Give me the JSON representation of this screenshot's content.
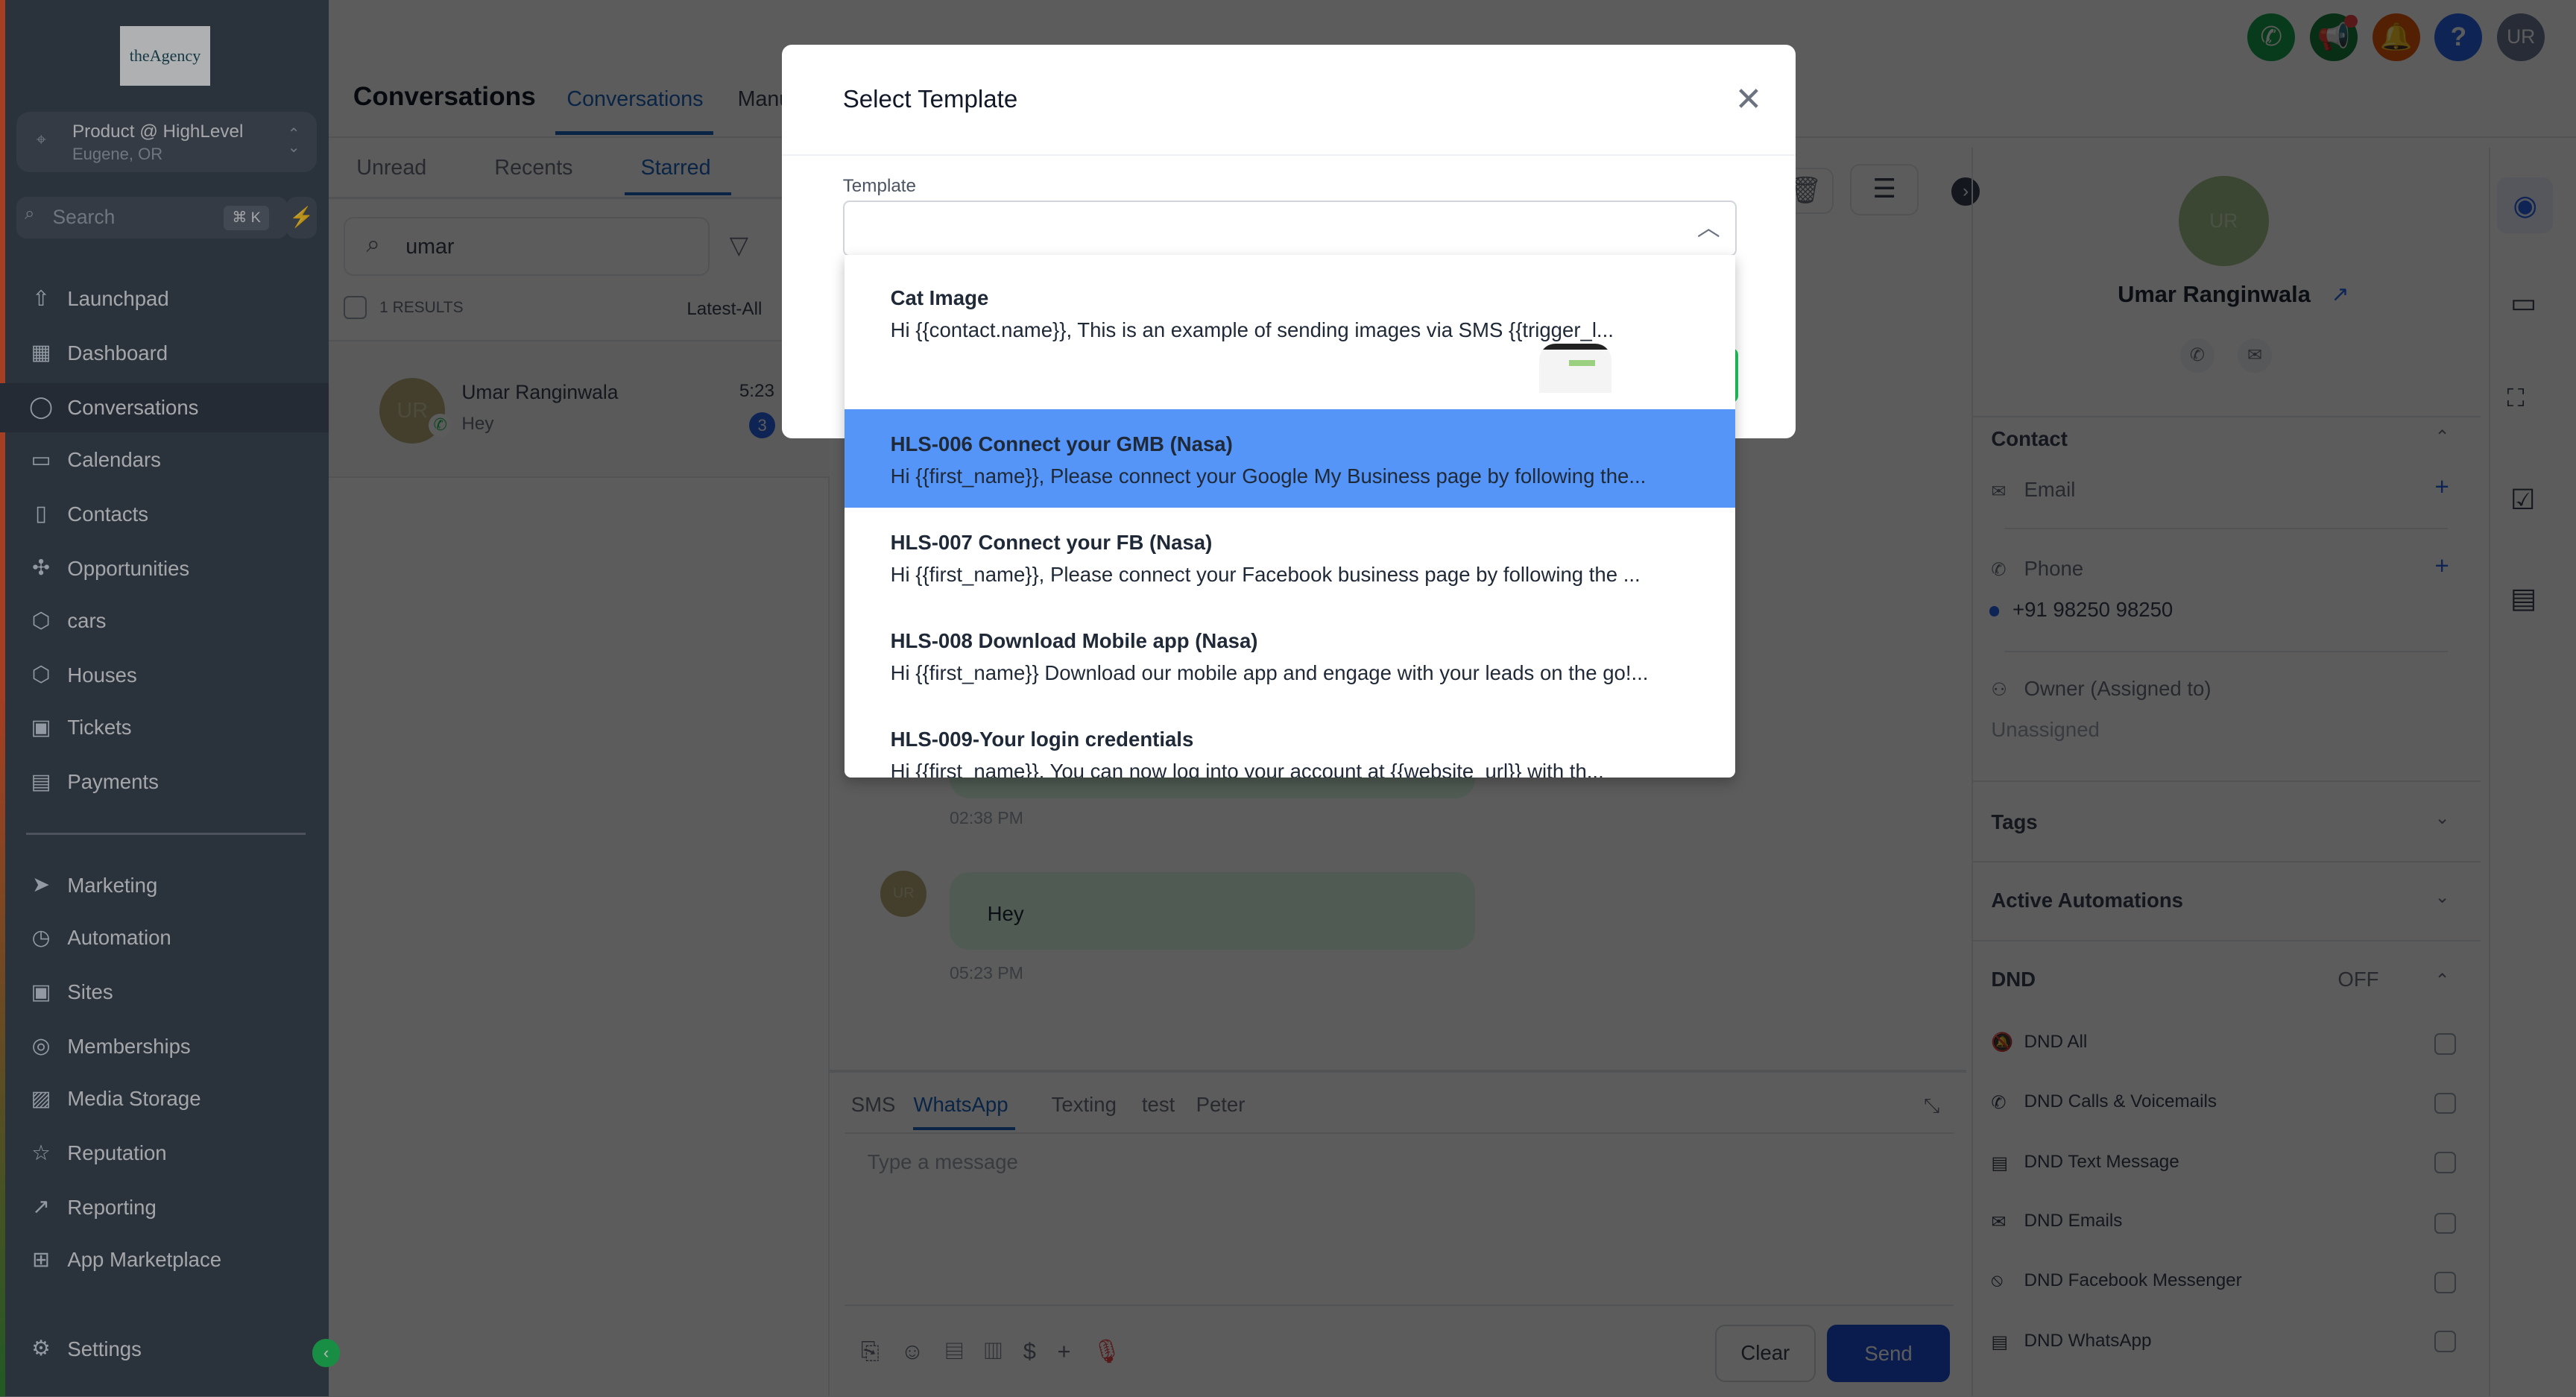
{
  "sidebar": {
    "logo": "theAgency",
    "location": {
      "name": "Product @ HighLevel",
      "sub": "Eugene, OR"
    },
    "search": {
      "placeholder": "Search",
      "shortcut": "⌘ K"
    },
    "items": [
      {
        "label": "Launchpad",
        "icon": "launchpad-icon"
      },
      {
        "label": "Dashboard",
        "icon": "dashboard-icon"
      },
      {
        "label": "Conversations",
        "icon": "chat-icon",
        "active": true
      },
      {
        "label": "Calendars",
        "icon": "calendar-icon"
      },
      {
        "label": "Contacts",
        "icon": "contacts-icon"
      },
      {
        "label": "Opportunities",
        "icon": "opportunities-icon"
      },
      {
        "label": "cars",
        "icon": "box-icon"
      },
      {
        "label": "Houses",
        "icon": "box-icon"
      },
      {
        "label": "Tickets",
        "icon": "ticket-icon"
      },
      {
        "label": "Payments",
        "icon": "payments-icon"
      }
    ],
    "items2": [
      {
        "label": "Marketing",
        "icon": "send-icon"
      },
      {
        "label": "Automation",
        "icon": "automation-icon"
      },
      {
        "label": "Sites",
        "icon": "sites-icon"
      },
      {
        "label": "Memberships",
        "icon": "memberships-icon"
      },
      {
        "label": "Media Storage",
        "icon": "image-icon"
      },
      {
        "label": "Reputation",
        "icon": "star-icon"
      },
      {
        "label": "Reporting",
        "icon": "reporting-icon"
      },
      {
        "label": "App Marketplace",
        "icon": "apps-icon"
      }
    ],
    "settings": "Settings"
  },
  "header": {
    "title": "Conversations",
    "tabs": [
      "Conversations",
      "Manual Actions"
    ],
    "avatar": "UR"
  },
  "list": {
    "subtabs": [
      "Unread",
      "Recents",
      "Starred"
    ],
    "search_value": "umar",
    "results": "1 RESULTS",
    "sort": "Latest-All",
    "items": [
      {
        "initials": "UR",
        "name": "Umar Ranginwala",
        "preview": "Hey",
        "time": "5:23",
        "badge": "3"
      }
    ]
  },
  "chat": {
    "messages": [
      {
        "time": "02:38 PM"
      },
      {
        "text": "Hey",
        "time": "05:23 PM",
        "initials": "UR"
      }
    ],
    "composer": {
      "tabs": [
        "SMS",
        "WhatsApp",
        "Texting",
        "test",
        "Peter"
      ],
      "active_tab": "WhatsApp",
      "placeholder": "Type a message",
      "clear": "Clear",
      "send": "Send"
    }
  },
  "contact": {
    "initials": "UR",
    "name": "Umar Ranginwala",
    "section": "Contact",
    "email_label": "Email",
    "phone_label": "Phone",
    "phone": "+91 98250 98250",
    "owner_label": "Owner (Assigned to)",
    "owner": "Unassigned",
    "tags": "Tags",
    "automations": "Active Automations",
    "dnd": "DND",
    "dnd_state": "OFF",
    "dnd_items": [
      "DND All",
      "DND Calls & Voicemails",
      "DND Text Message",
      "DND Emails",
      "DND Facebook Messenger",
      "DND WhatsApp"
    ]
  },
  "modal": {
    "title": "Select Template",
    "field_label": "Template",
    "options": [
      {
        "title": "Cat Image",
        "preview": "Hi {{contact.name}}, This is an example of sending images via SMS {{trigger_l..."
      },
      {
        "title": "HLS-006 Connect your GMB (Nasa)",
        "preview": "Hi {{first_name}}, Please connect your Google My Business page by following the...",
        "highlighted": true
      },
      {
        "title": "HLS-007 Connect your FB (Nasa)",
        "preview": "Hi {{first_name}}, Please connect your Facebook business page by following the ..."
      },
      {
        "title": "HLS-008 Download Mobile app (Nasa)",
        "preview": "Hi {{first_name}} Download our mobile app and engage with your leads on the go!..."
      },
      {
        "title": "HLS-009-Your login credentials",
        "preview": "Hi {{first_name}}, You can now log into your account at {{website_url}} with th..."
      }
    ]
  },
  "colors": {
    "accent": "#1d64c2",
    "highlight": "#5595f7",
    "success": "#22c55e"
  }
}
